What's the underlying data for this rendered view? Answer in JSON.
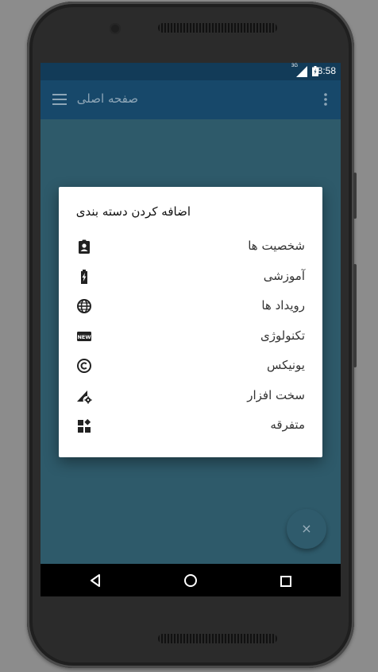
{
  "status_bar": {
    "network": "3G",
    "time": "8:58"
  },
  "app_bar": {
    "title": "صفحه اصلی",
    "menu_icon": "hamburger-menu-icon",
    "overflow_icon": "more-vert-icon"
  },
  "dialog": {
    "title": "اضافه کردن دسته بندی",
    "items": [
      {
        "label": "شخصیت ها",
        "icon": "person-badge-icon"
      },
      {
        "label": "آموزشی",
        "icon": "battery-charging-icon"
      },
      {
        "label": "رویداد ها",
        "icon": "globe-icon"
      },
      {
        "label": "تکنولوژی",
        "icon": "new-badge-icon"
      },
      {
        "label": "یونیکس",
        "icon": "copyright-icon"
      },
      {
        "label": "سخت افزار",
        "icon": "signal-settings-icon"
      },
      {
        "label": "متفرقه",
        "icon": "widgets-icon"
      }
    ]
  },
  "fab": {
    "symbol": "×",
    "icon": "close-icon"
  },
  "colors": {
    "status_bar": "#123b58",
    "app_bar": "#17486a",
    "content": "#2e5a6a",
    "dialog": "#ffffff"
  }
}
